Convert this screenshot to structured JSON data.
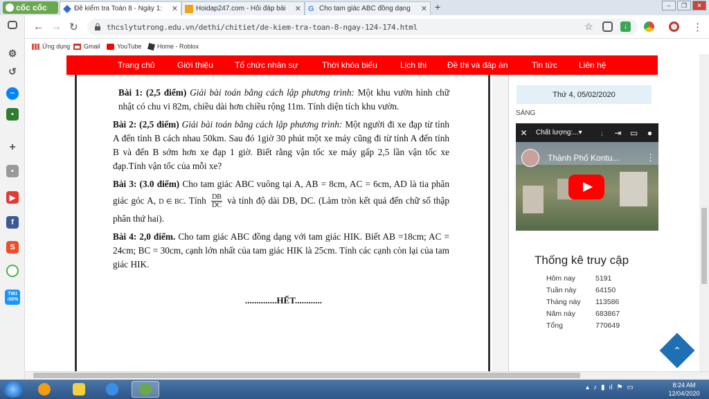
{
  "browser": {
    "brand": "cốc cốc",
    "tabs": [
      {
        "title": "Đề kiểm tra Toán 8 - Ngày 1:",
        "active": true
      },
      {
        "title": "Hoidap247.com - Hỏi đáp bài",
        "active": false
      },
      {
        "title": "Cho tam giác ABC đồng dạng",
        "active": false
      }
    ],
    "new_tab": "+",
    "url": "thcslytutrong.edu.vn/dethi/chitiet/de-kiem-tra-toan-8-ngay-124-174.html",
    "bookmarks": [
      {
        "label": "Ứng dụng",
        "icon": "apps-icon"
      },
      {
        "label": "Gmail",
        "icon": "gmail-icon"
      },
      {
        "label": "YouTube",
        "icon": "youtube-icon"
      },
      {
        "label": "Home - Roblox",
        "icon": "roblox-icon"
      }
    ]
  },
  "sidebar": {
    "shopee_badge": "S",
    "tiki_label": "TIKI -50%"
  },
  "site_nav": [
    "Trang chủ",
    "Giới thiệu",
    "Tổ chức nhân sự",
    "Thời khóa biểu",
    "Lịch thi",
    "Đề thi và đáp án",
    "Tin tức",
    "Liên hệ"
  ],
  "exam": {
    "q1": {
      "head": "Bài 1: (2,5 điểm)",
      "instr": "Giải bài toán bằng cách lập phương trình:",
      "text": " Một khu vườn hình chữ nhật có chu vi 82m, chiều dài hơn chiều rộng 11m. Tính diện tích khu vườn."
    },
    "q2": {
      "head": "Bài 2: (2,5 điểm)",
      "instr": "Giải bài toán bằng cách lập phương trình:",
      "text": " Một người đi xe đạp từ tỉnh A đến tỉnh B cách nhau 50km. Sau đó 1giờ 30 phút một xe máy cũng đi từ tỉnh A đến tỉnh B và đến B sớm hơn xe đạp 1 giờ. Biết rằng vận tốc xe máy gấp 2,5 lần vận tốc xe đạp.Tính vận tốc của mỗi xe?"
    },
    "q3": {
      "head": "Bài 3: (3.0 điểm)",
      "text1": " Cho tam giác ABC vuông tại A,  AB = 8cm, AC = 6cm, AD là tia phân giác góc A, ",
      "cond": "D ∈ BC",
      "text2": ". Tính ",
      "frac_num": "DB",
      "frac_den": "DC",
      "text3": " và tính độ dài DB, DC. (Làm tròn kết quả đến chữ số thập phân thứ hai)."
    },
    "q4": {
      "head": "Bài 4: 2,0 điểm.",
      "text": " Cho tam giác ABC đồng dạng với tam giác HIK. Biết AB =18cm; AC = 24cm; BC = 30cm, cạnh lớn nhất của tam giác HIK là 25cm. Tính các cạnh còn lại của tam giác HIK."
    },
    "end": "..............HẾT............"
  },
  "right": {
    "date": "Thứ 4, 05/02/2020",
    "session": "SÁNG",
    "video": {
      "quality": "Chất lượng:...",
      "title": "Thành Phố Kontu..."
    },
    "stats_title": "Thống kê truy cập",
    "stats": [
      {
        "label": "Hôm nay",
        "value": "5191"
      },
      {
        "label": "Tuần này",
        "value": "64150"
      },
      {
        "label": "Tháng này",
        "value": "113586"
      },
      {
        "label": "Năm này",
        "value": "683867"
      },
      {
        "label": "Tổng",
        "value": "770649"
      }
    ]
  },
  "taskbar": {
    "time": "8:24 AM",
    "date": "12/04/2020"
  }
}
